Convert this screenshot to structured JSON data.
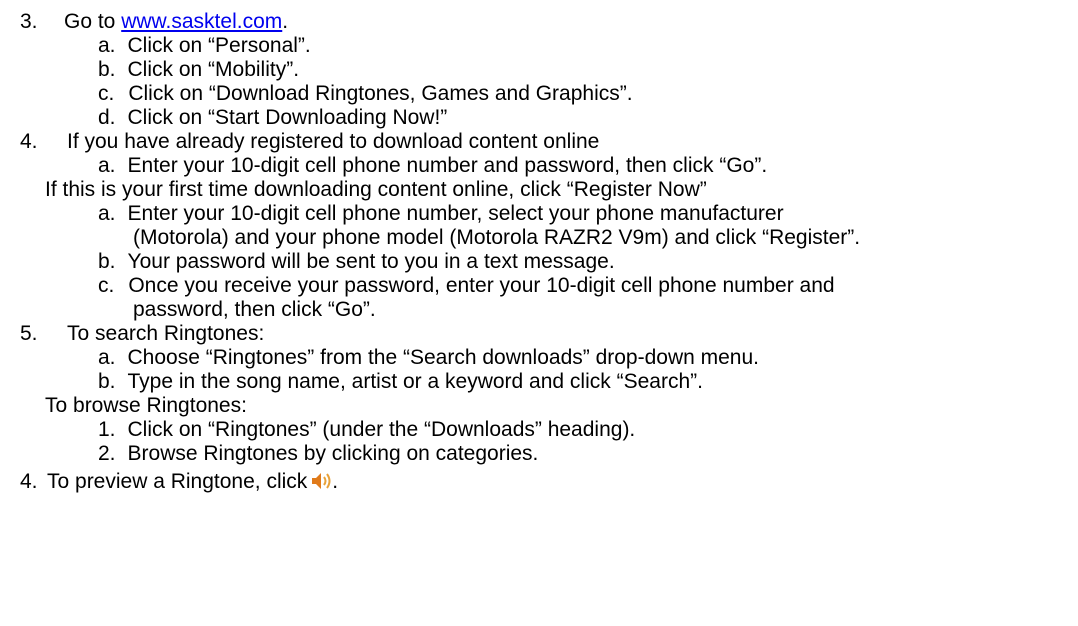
{
  "steps": {
    "s3": {
      "num": "3.",
      "text_before": "Go to ",
      "link": "www.sasktel.com",
      "text_after": ".",
      "subs": [
        {
          "marker": "a.",
          "text": "Click on “Personal”."
        },
        {
          "marker": "b.",
          "text": "Click on “Mobility”."
        },
        {
          "marker": "c.",
          "text": "Click on “Download Ringtones, Games and Graphics”."
        },
        {
          "marker": "d.",
          "text": "Click on “Start Downloading Now!”"
        }
      ]
    },
    "s4": {
      "num": "4.",
      "text": "If you have already registered to download content online",
      "subs": [
        {
          "marker": "a.",
          "text": "Enter your 10-digit cell phone number and password, then click “Go”."
        }
      ],
      "first_time": "If this is your first time downloading content online, click “Register Now”",
      "first_time_subs": [
        {
          "marker": "a.",
          "lines": [
            "Enter your 10-digit cell phone number, select your phone manufacturer",
            "(Motorola) and your phone model (Motorola RAZR2 V9m) and click “Register”."
          ]
        },
        {
          "marker": "b.",
          "lines": [
            "Your password will be sent to you in a text message."
          ]
        },
        {
          "marker": "c.",
          "lines": [
            "Once you receive your password, enter your 10-digit cell phone number and",
            "password, then click “Go”."
          ]
        }
      ]
    },
    "s5": {
      "num": "5.",
      "text": "To search Ringtones:",
      "subs": [
        {
          "marker": "a.",
          "text": "Choose “Ringtones” from the “Search downloads” drop-down menu."
        },
        {
          "marker": "b.",
          "text": "Type in the song name, artist or a keyword and click “Search”."
        }
      ],
      "browse": "To browse Ringtones:",
      "browse_subs": [
        {
          "marker": "1.",
          "text": "Click on “Ringtones” (under the “Downloads” heading)."
        },
        {
          "marker": "2.",
          "text": "Browse Ringtones by clicking on categories."
        }
      ]
    },
    "s6": {
      "num": "4.",
      "text": "To preview a Ringtone, click",
      "after_icon": ".",
      "icon": "speaker-icon"
    }
  },
  "colors": {
    "link": "#0000ee",
    "speaker_body": "#e07a1a",
    "speaker_waves": "#e8a23a"
  }
}
